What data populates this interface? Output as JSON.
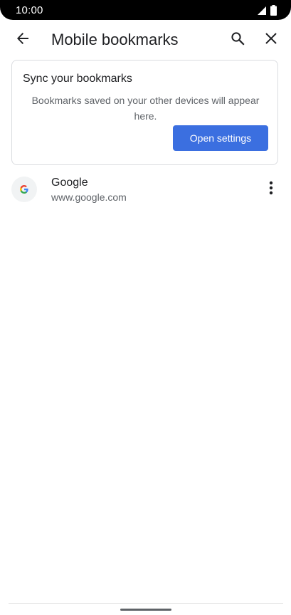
{
  "status_bar": {
    "time": "10:00",
    "icons": [
      "signal-icon",
      "battery-icon"
    ]
  },
  "app_bar": {
    "title": "Mobile bookmarks",
    "icons": {
      "back": "arrow-back-icon",
      "search": "search-icon",
      "close": "close-icon"
    }
  },
  "sync_card": {
    "title": "Sync your bookmarks",
    "description": "Bookmarks saved on your other devices will appear here.",
    "button_label": "Open settings"
  },
  "bookmarks": [
    {
      "title": "Google",
      "url": "www.google.com",
      "favicon_letter": "G",
      "menu_icon": "more-vert-icon"
    }
  ],
  "colors": {
    "accent": "#3b6fe0",
    "text_primary": "#202124",
    "text_secondary": "#5f6368",
    "card_border": "#dadce0"
  }
}
